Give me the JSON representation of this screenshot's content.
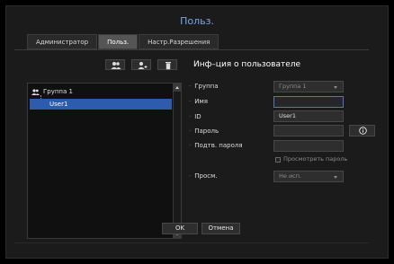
{
  "dialog": {
    "title": "Польз."
  },
  "tabs": [
    {
      "label": "Администратор"
    },
    {
      "label": "Польз."
    },
    {
      "label": "Настр.Разрешения"
    }
  ],
  "toolbar": {
    "icons": [
      "add-group-icon",
      "add-user-icon",
      "delete-icon"
    ]
  },
  "tree": {
    "group": {
      "label": "Группа 1",
      "icon": "group-icon"
    },
    "selected_user": {
      "label": "User1"
    }
  },
  "info": {
    "heading": "Инф–ция о пользователе",
    "fields": {
      "group": {
        "label": "Группа",
        "value": "Группа 1"
      },
      "name": {
        "label": "Имя",
        "value": ""
      },
      "id": {
        "label": "ID",
        "value": "User1"
      },
      "password": {
        "label": "Пароль",
        "value": ""
      },
      "confirm_password": {
        "label": "Подтв. пароля",
        "value": ""
      },
      "view": {
        "label": "Просм.",
        "value": "Не исп."
      }
    },
    "show_password_label": "Просмотреть пароль"
  },
  "buttons": {
    "ok": "OK",
    "cancel": "Отмена"
  },
  "colors": {
    "accent": "#2c5cab",
    "title": "#7aa7e8",
    "focus": "#4a78c8"
  }
}
